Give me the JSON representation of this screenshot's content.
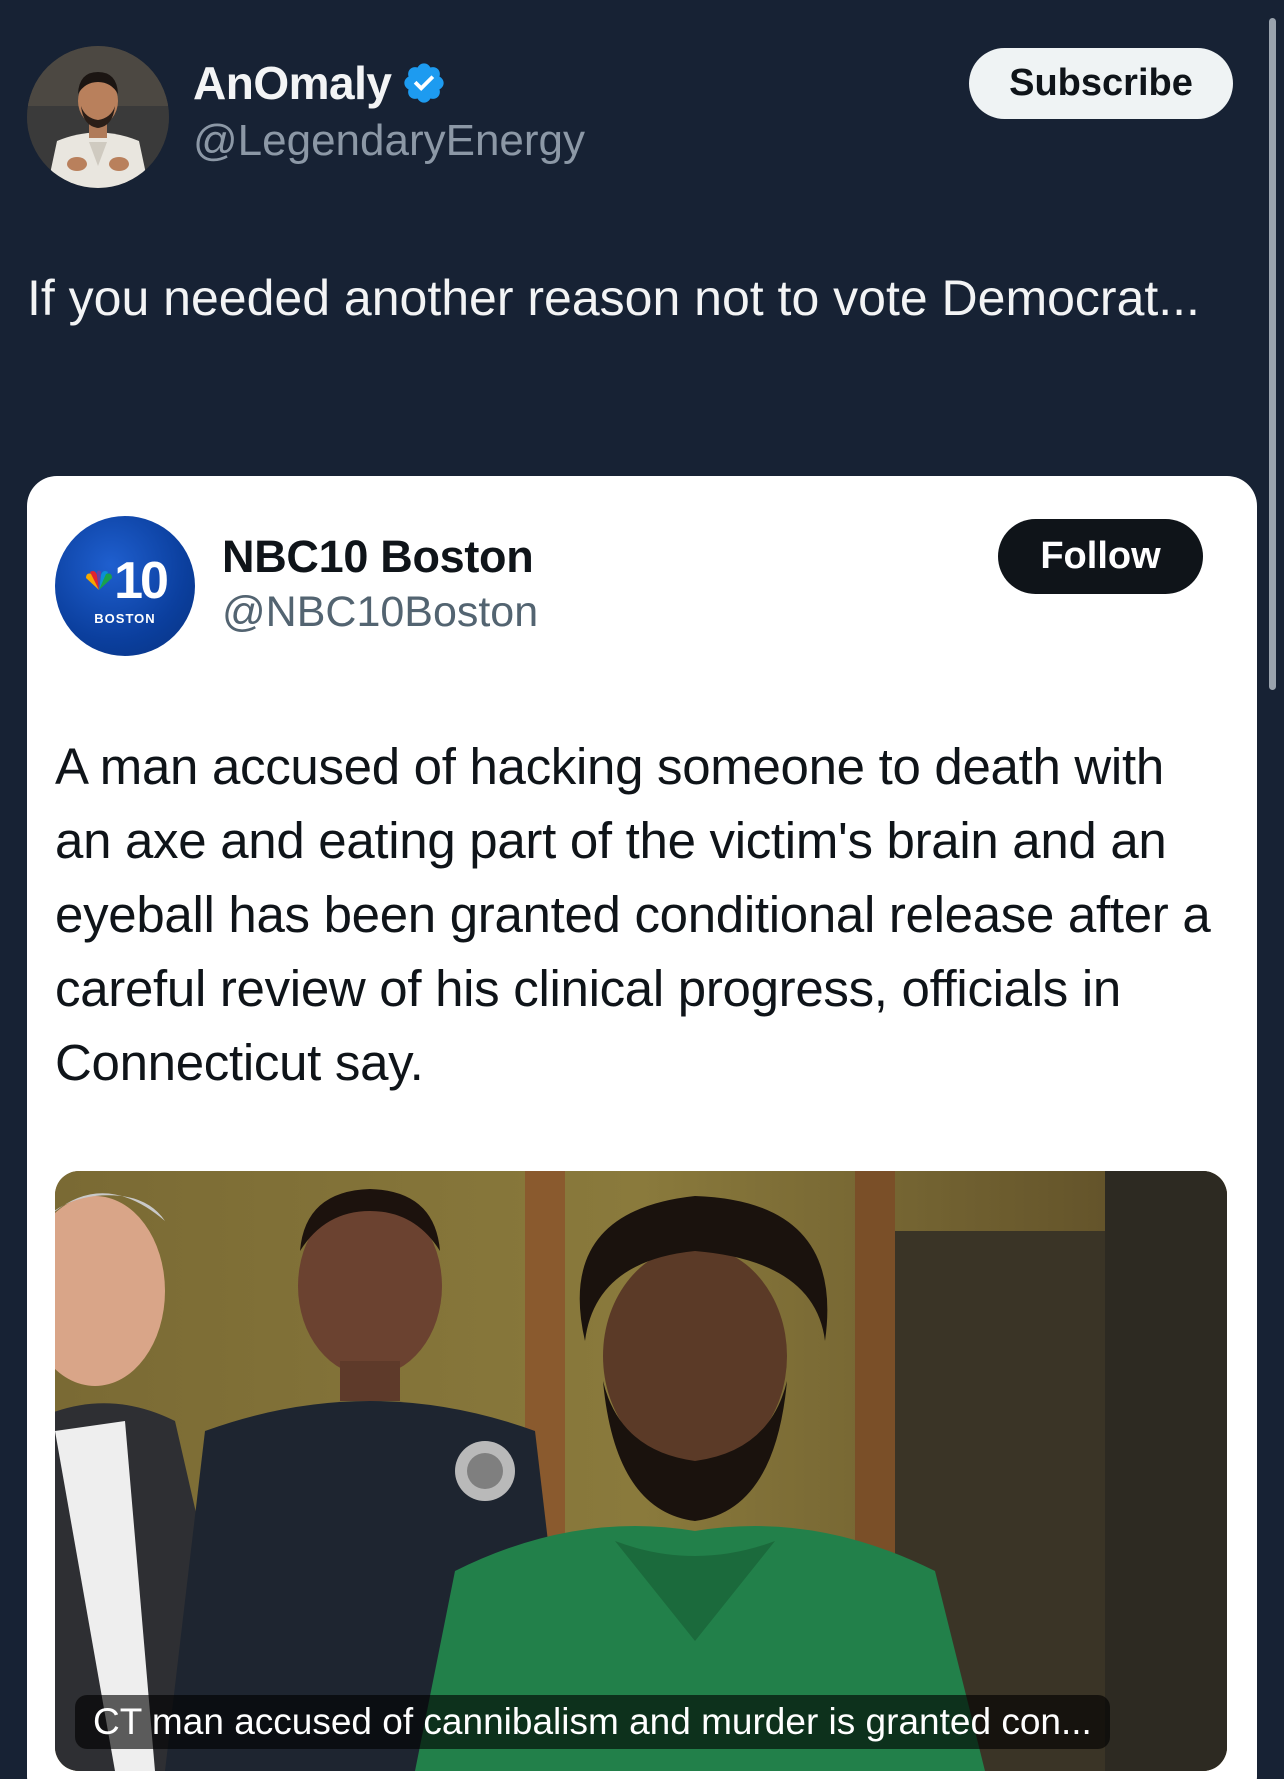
{
  "author": {
    "name": "AnOmaly",
    "handle": "@LegendaryEnergy",
    "verified_icon": "verified-badge-icon",
    "verified_color": "#1d9bf0"
  },
  "subscribe_label": "Subscribe",
  "tweet_text": "If you needed another reason not to vote Democrat...",
  "quoted": {
    "name": "NBC10 Boston",
    "handle": "@NBC10Boston",
    "logo_number": "10",
    "logo_sub": "BOSTON",
    "follow_label": "Follow",
    "text": "A man accused of hacking someone to death with an axe and eating part of the victim's brain and an eyeball has been granted conditional release after a careful review of his clinical progress, officials in Connecticut say.",
    "media_caption": "CT man accused of cannibalism and murder is granted con..."
  },
  "colors": {
    "background": "#172234",
    "card": "#ffffff",
    "follow_button": "#0f1419",
    "subscribe_button": "#eff3f4"
  }
}
